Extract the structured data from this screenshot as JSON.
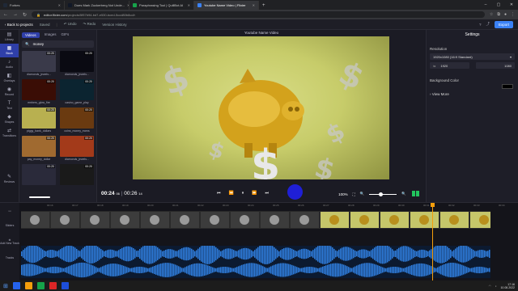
{
  "browser": {
    "tabs": [
      {
        "label": "Forbes",
        "color": "#1f2937"
      },
      {
        "label": "Does Mark Zuckerberg Not Unde...",
        "color": "#111827"
      },
      {
        "label": "Paraphrasing Tool | QuillBot AI",
        "color": "#16a34a"
      },
      {
        "label": "Youtube Name Video | Flixier",
        "color": "#3b82f6"
      }
    ],
    "url_host": "editor.flixier.com",
    "url_path": "/projects/5f57b94-bd7-e530-bced-5ccd80b8cd/r"
  },
  "topbar": {
    "back": "Back to projects",
    "saved": "Saved",
    "undo": "Undo",
    "redo": "Redo",
    "version_history": "Version History",
    "export": "Export"
  },
  "left_rail": [
    {
      "label": "Library",
      "icon": "library-icon"
    },
    {
      "label": "Stock",
      "icon": "stock-icon"
    },
    {
      "label": "Audio",
      "icon": "music-icon"
    },
    {
      "label": "Overlays",
      "icon": "overlays-icon"
    },
    {
      "label": "Record",
      "icon": "record-icon"
    },
    {
      "label": "Text",
      "icon": "text-icon"
    },
    {
      "label": "Shapes",
      "icon": "shapes-icon"
    },
    {
      "label": "Transitions",
      "icon": "transitions-icon"
    },
    {
      "label": "Reviews",
      "icon": "reviews-icon"
    }
  ],
  "media": {
    "tabs": [
      "Videos",
      "Images",
      "GIFs"
    ],
    "search_value": "money",
    "items": [
      {
        "caption": "diamonds_jewels...",
        "duration": "00:20",
        "color": "#3a3a4a"
      },
      {
        "caption": "diamonds_jewels...",
        "duration": "00:20",
        "color": "#0a0a12"
      },
      {
        "caption": "embers_glow_fire",
        "duration": "00:20",
        "color": "#3a0d05"
      },
      {
        "caption": "casino_game_play",
        "duration": "00:20",
        "color": "#0b2430"
      },
      {
        "caption": "piggy_bank_dollars",
        "duration": "00:20",
        "color": "#b8b050"
      },
      {
        "caption": "coins_money_earns",
        "duration": "00:20",
        "color": "#6a3a10"
      },
      {
        "caption": "pay_money_dollar",
        "duration": "00:20",
        "color": "#a06a30"
      },
      {
        "caption": "diamonds_jewels...",
        "duration": "00:20",
        "color": "#a33a1a"
      },
      {
        "caption": "",
        "duration": "00:20",
        "color": "#2a2a3a"
      },
      {
        "caption": "",
        "duration": "00:20",
        "color": "#1a1a1a"
      }
    ]
  },
  "preview": {
    "title": "Youtube Name Video",
    "current_time": "00:24",
    "current_frame": "06",
    "total_time": "00:26",
    "total_frame": "14",
    "zoom": "100%"
  },
  "settings": {
    "header": "Settings",
    "resolution_label": "Resolution",
    "resolution_value": "1920x1080 (16:9 Standard)",
    "width": "1920",
    "height": "1080",
    "bg_label": "Background Color",
    "view_more": "View More"
  },
  "timeline": {
    "rail": [
      "Sliders",
      "Add New Track",
      "Tracks"
    ],
    "ruler": [
      "00:16",
      "00:17",
      "00:18",
      "00:19",
      "00:20",
      "00:21",
      "00:22",
      "00:23",
      "00:24",
      "00:25",
      "00:26",
      "00:27",
      "00:28",
      "00:29",
      "00:30",
      "00:31",
      "00:32",
      "00:33",
      "00:34",
      "00:35"
    ]
  },
  "taskbar": {
    "time": "17:16",
    "date": "10.08.2022"
  },
  "colors": {
    "accent": "#3b82f6",
    "playhead": "#f59e0b",
    "waveform": "#2f7fe0"
  }
}
